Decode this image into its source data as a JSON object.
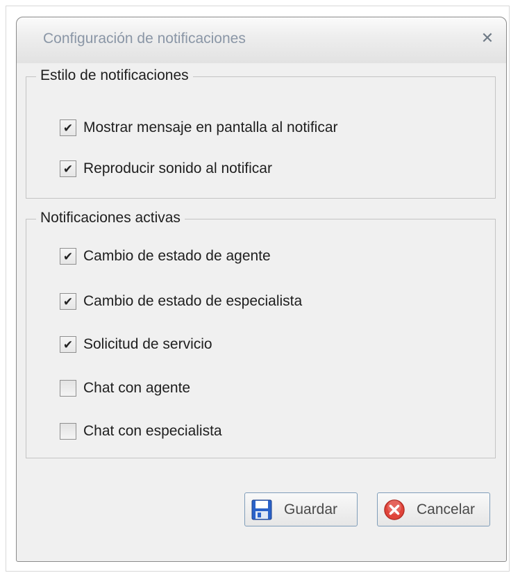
{
  "dialog": {
    "title": "Configuración de notificaciones",
    "close_symbol": "✕"
  },
  "groups": [
    {
      "legend": "Estilo de notificaciones",
      "options": [
        {
          "label": "Mostrar mensaje en pantalla al notificar",
          "checked": true
        },
        {
          "label": "Reproducir sonido al notificar",
          "checked": true
        }
      ]
    },
    {
      "legend": "Notificaciones activas",
      "options": [
        {
          "label": "Cambio de estado de agente",
          "checked": true
        },
        {
          "label": "Cambio de estado de especialista",
          "checked": true
        },
        {
          "label": "Solicitud de servicio",
          "checked": true
        },
        {
          "label": "Chat con agente",
          "checked": false
        },
        {
          "label": "Chat con especialista",
          "checked": false
        }
      ]
    }
  ],
  "check_mark": "✔",
  "buttons": {
    "save_label": "Guardar",
    "save_icon": "floppy-disk-icon",
    "cancel_label": "Cancelar",
    "cancel_icon": "red-x-circle-icon"
  }
}
